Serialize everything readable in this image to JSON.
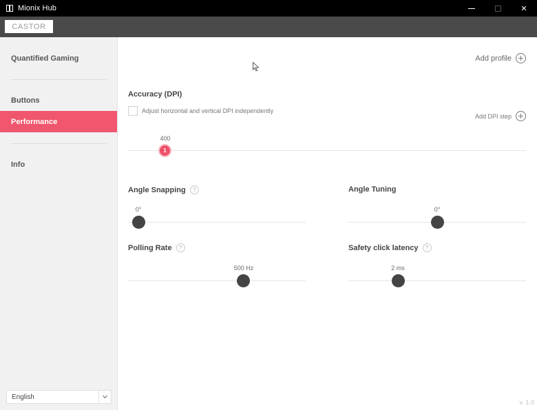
{
  "window": {
    "title": "Mionix Hub"
  },
  "device": {
    "tab_label": "CASTOR"
  },
  "sidebar": {
    "items": [
      {
        "label": "Quantified Gaming"
      },
      {
        "label": "Buttons"
      },
      {
        "label": "Performance",
        "active": true
      },
      {
        "label": "Info"
      }
    ],
    "language": "English"
  },
  "header": {
    "add_profile_label": "Add profile"
  },
  "accuracy": {
    "title": "Accuracy (DPI)",
    "independent_label": "Adjust horizontal and vertical DPI independently",
    "independent_checked": false,
    "add_step_label": "Add DPI step",
    "step_value": "400",
    "step_number": "1"
  },
  "angle_snapping": {
    "title": "Angle Snapping",
    "value": "0°",
    "help": "?"
  },
  "angle_tuning": {
    "title": "Angle Tuning",
    "value": "0°"
  },
  "polling_rate": {
    "title": "Polling Rate",
    "value": "500 Hz",
    "help": "?"
  },
  "safety_click": {
    "title": "Safety click latency",
    "value": "2 ms",
    "help": "?"
  },
  "footer": {
    "version": "v. 1.0"
  },
  "colors": {
    "accent": "#f0566d",
    "titlebar": "#000000",
    "device_bar": "#4a4a4a",
    "sidebar_bg": "#f1f1f1"
  }
}
